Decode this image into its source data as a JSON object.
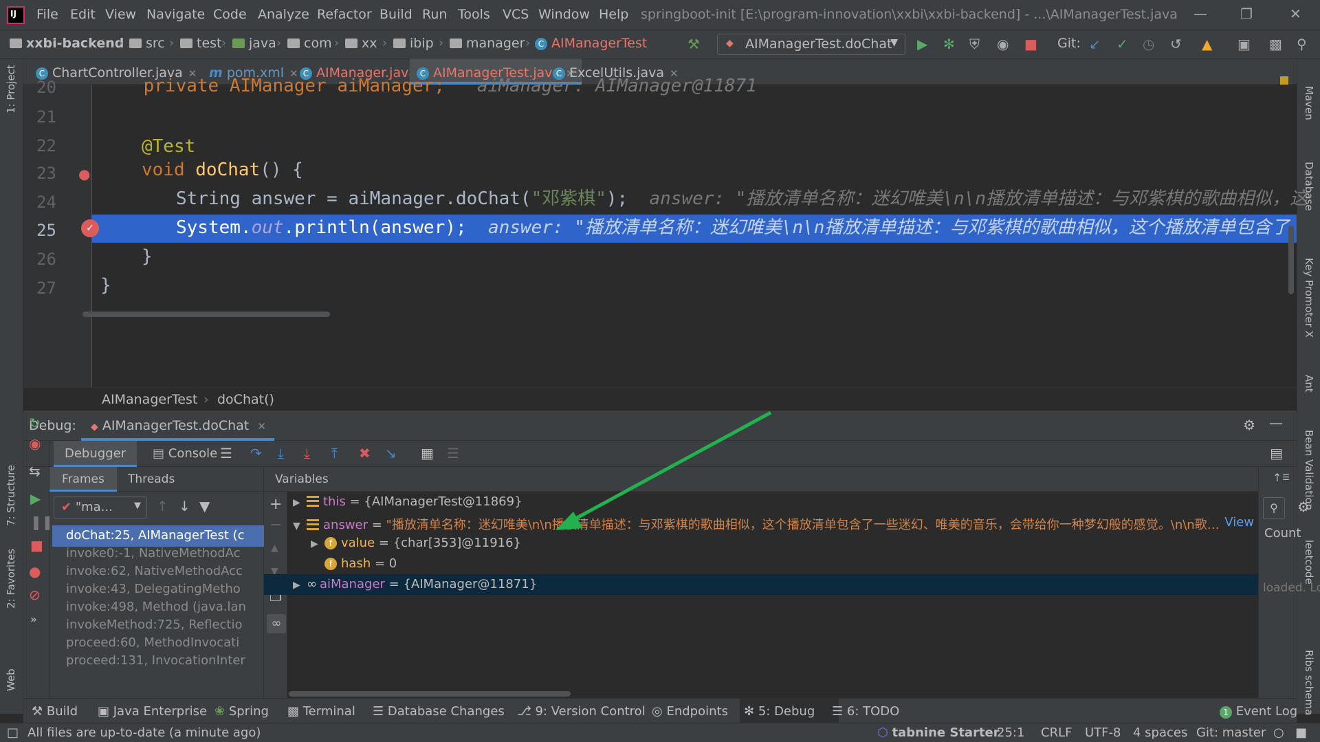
{
  "menu": {
    "items": [
      "File",
      "Edit",
      "View",
      "Navigate",
      "Code",
      "Analyze",
      "Refactor",
      "Build",
      "Run",
      "Tools",
      "VCS",
      "Window",
      "Help"
    ],
    "window_title": "springboot-init [E:\\program-innovation\\xxbi\\xxbi-backend] - ...\\AIManagerTest.java"
  },
  "navbar": {
    "crumbs": [
      "xxbi-backend",
      "src",
      "test",
      "java",
      "com",
      "xx",
      "ibip",
      "manager",
      "AIManagerTest"
    ],
    "run_config": "AIManagerTest.doChat",
    "git_label": "Git:"
  },
  "tabs": [
    {
      "label": "ChartController.java",
      "icon": "class-icon"
    },
    {
      "label": "pom.xml",
      "icon": "maven-icon"
    },
    {
      "label": "AIManager.java",
      "icon": "class-icon"
    },
    {
      "label": "AIManagerTest.java",
      "icon": "class-icon",
      "active": true
    },
    {
      "label": "ExcelUtils.java",
      "icon": "class-icon"
    }
  ],
  "editor": {
    "line_numbers": [
      "20",
      "21",
      "22",
      "23",
      "24",
      "25",
      "26",
      "27"
    ],
    "lines": {
      "l20_code": "    private AIManager aiManager;",
      "l20_hint": "aiManager: AIManager@11871",
      "l22_annotation": "@Test",
      "l23_kw": "void",
      "l23_fn": "doChat",
      "l23_rest": "() {",
      "l24_code_a": "String answer = aiManager.doChat(",
      "l24_str": "\"邓紫棋\"",
      "l24_code_b": ");",
      "l24_hint": "answer: \"播放清单名称：迷幻唯美\\n\\n播放清单描述：与邓紫棋的歌曲相似，这",
      "l25_code_a": "System.",
      "l25_out": "out",
      "l25_code_b": ".println(answer);",
      "l25_hint": "answer: \"播放清单名称：迷幻唯美\\n\\n播放清单描述：与邓紫棋的歌曲相似，这个播放清单包含了",
      "l26_code": "}",
      "l27_code": "}"
    },
    "breadcrumb": [
      "AIManagerTest",
      "doChat()"
    ]
  },
  "debug": {
    "title": "Debug:",
    "session_tab": "AIManagerTest.doChat",
    "tabs": [
      "Debugger",
      "Console"
    ],
    "subtabs": [
      "Frames",
      "Threads"
    ],
    "thread_select": "\"ma...",
    "variables_title": "Variables",
    "frames": [
      "doChat:25, AIManagerTest (c",
      "invoke0:-1, NativeMethodAc",
      "invoke:62, NativeMethodAcc",
      "invoke:43, DelegatingMetho",
      "invoke:498, Method (java.lan",
      "invokeMethod:725, Reflectio",
      "proceed:60, MethodInvocati",
      "proceed:131, InvocationInter"
    ],
    "variables": [
      {
        "name": "this",
        "value": "{AIManagerTest@11869}"
      },
      {
        "name": "answer",
        "value": "\"播放清单名称：迷幻唯美\\n\\n播放清单描述：与邓紫棋的歌曲相似，这个播放清单包含了一些迷幻、唯美的音乐，会带给你一种梦幻般的感觉。\\n\\n歌…",
        "link": "View"
      },
      {
        "name": "value",
        "value": "{char[353]@11916}"
      },
      {
        "name": "hash",
        "value": "0"
      },
      {
        "name": "aiManager",
        "value": "{AIManager@11871}"
      }
    ],
    "right_panel": {
      "count_label": "Count",
      "loaded_text": "loaded. Lo"
    }
  },
  "toolwindows": [
    "Build",
    "Java Enterprise",
    "Spring",
    "Terminal",
    "Database Changes",
    "9: Version Control",
    "Endpoints",
    "5: Debug",
    "6: TODO",
    "Event Log"
  ],
  "left_stripe": [
    "1: Project",
    "7: Structure",
    "2: Favorites",
    "Web"
  ],
  "right_stripe": [
    "Maven",
    "Database",
    "Key Promoter X",
    "Ant",
    "Bean Validation",
    "leetcode",
    "Ribs schema"
  ],
  "status": {
    "message": "All files are up-to-date (a minute ago)",
    "tabnine": "tabnine Starter",
    "position": "25:1",
    "line_sep": "CRLF",
    "encoding": "UTF-8",
    "indent": "4 spaces",
    "git": "Git: master"
  },
  "colors": {
    "accent": "#4a88c7",
    "selection": "#2f65ca",
    "arrow": "#22b14c"
  }
}
